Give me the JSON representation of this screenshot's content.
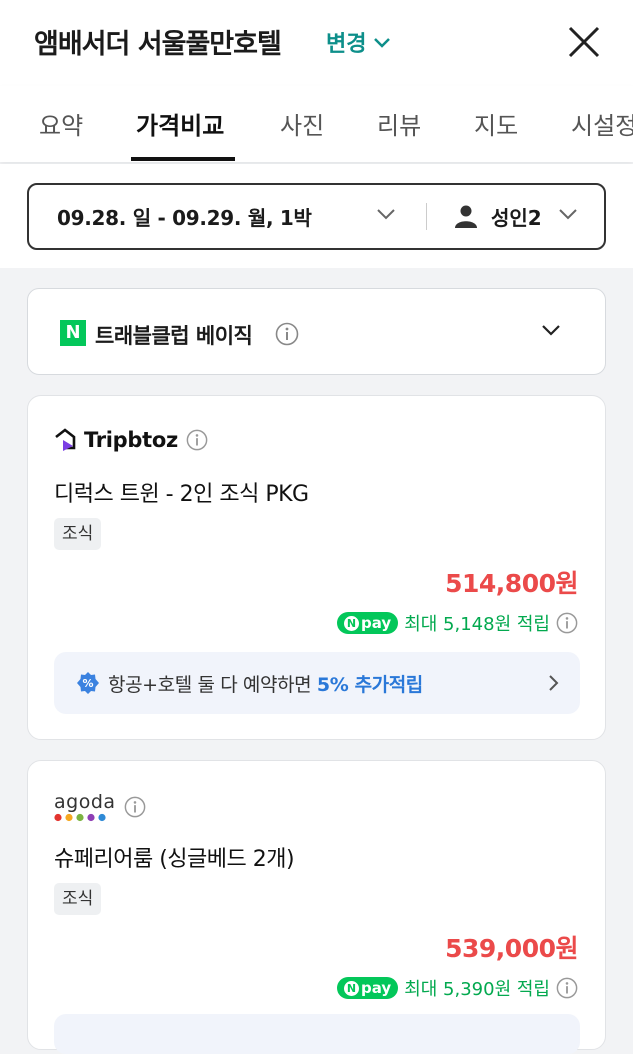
{
  "header": {
    "title": "앰배서더 서울풀만호텔",
    "change_label": "변경"
  },
  "tabs": [
    {
      "label": "요약"
    },
    {
      "label": "가격비교"
    },
    {
      "label": "사진"
    },
    {
      "label": "리뷰"
    },
    {
      "label": "지도"
    },
    {
      "label": "시설정"
    }
  ],
  "active_tab": "가격비교",
  "filters": {
    "dates": "09.28. 일 - 09.29. 월, 1박",
    "guests": "성인2"
  },
  "club": {
    "logo_letter": "N",
    "label": "트래블클럽 베이직"
  },
  "offers": [
    {
      "provider": "Tripbtoz",
      "room": "디럭스 트윈 - 2인 조식 PKG",
      "badge": "조식",
      "price": "514,800원",
      "npay_label": "pay",
      "points": "최대 5,148원 적립",
      "promo_prefix": "항공+호텔 둘 다 예약하면 ",
      "promo_highlight": "5% 추가적립"
    },
    {
      "provider": "agoda",
      "room": "슈페리어룸 (싱글베드 2개)",
      "badge": "조식",
      "price": "539,000원",
      "npay_label": "pay",
      "points": "최대 5,390원 적립"
    }
  ],
  "colors": {
    "accent": "#0d8f8a",
    "price": "#eb4a4a",
    "npay": "#03c75a",
    "promo_highlight": "#2a78d8"
  }
}
